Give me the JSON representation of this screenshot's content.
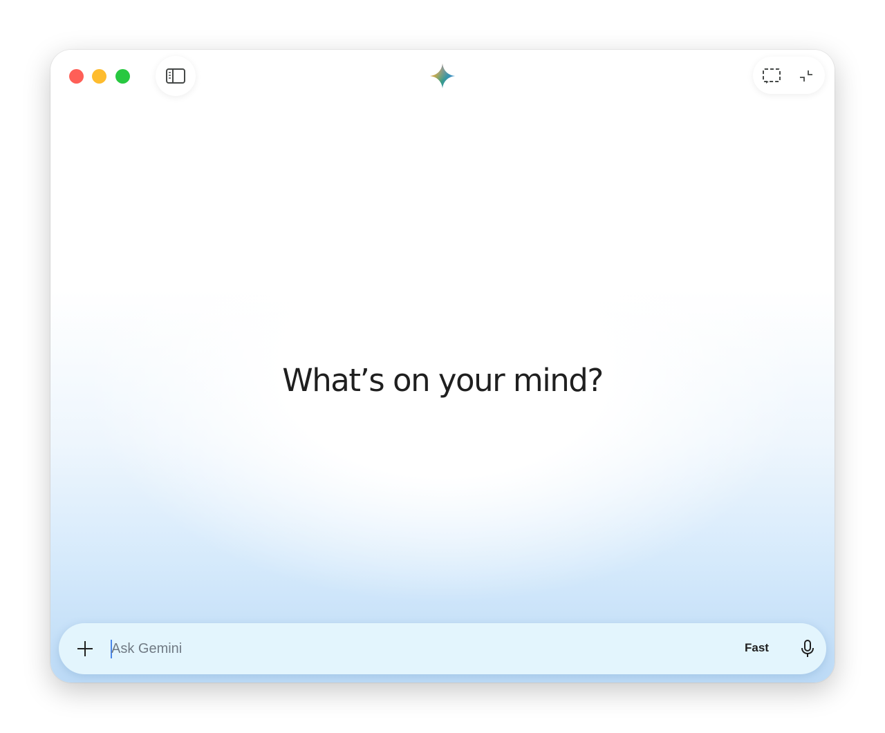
{
  "window": {
    "controls": {
      "close": "close",
      "minimize": "minimize",
      "maximize": "maximize"
    }
  },
  "icons": {
    "sidebar_toggle": "sidebar-icon",
    "logo": "gemini-logo-icon",
    "screen_capture": "screen-capture-icon",
    "collapse": "collapse-icon",
    "add": "plus-icon",
    "microphone": "microphone-icon"
  },
  "main": {
    "greeting": "What’s on your mind?"
  },
  "input": {
    "placeholder": "Ask Gemini",
    "value": "",
    "mode_label": "Fast"
  },
  "colors": {
    "traffic_close": "#fe5f57",
    "traffic_minimize": "#febc2e",
    "traffic_maximize": "#28c840",
    "input_background": "#e3f5fd",
    "cursor": "#4a86e8"
  }
}
